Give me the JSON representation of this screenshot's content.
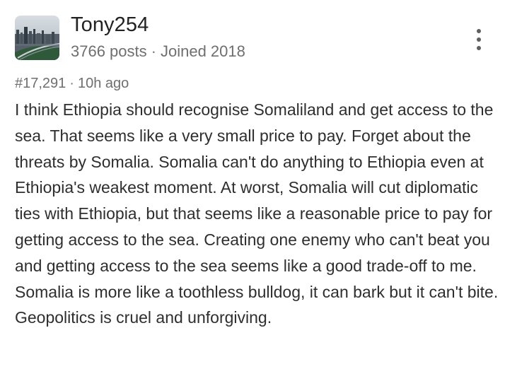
{
  "author": {
    "name": "Tony254",
    "posts": "3766 posts",
    "joined": "Joined 2018"
  },
  "post": {
    "number": "#17,291",
    "time": "10h ago",
    "body": "I think Ethiopia should recognise Somaliland and get access to the sea. That seems like a very small price to pay. Forget about the threats by Somalia. Somalia can't do anything to Ethiopia even at Ethiopia's weakest moment. At worst, Somalia will cut diplomatic ties with Ethiopia, but that seems like a reasonable price to pay for getting access to the sea. Creating one enemy who can't beat you and getting access to the sea seems like a good trade-off to me. Somalia is more like a toothless bulldog, it can bark but it can't bite. Geopolitics is cruel and unforgiving."
  },
  "separator": "·",
  "icons": {
    "menu": "more-vertical-icon"
  }
}
